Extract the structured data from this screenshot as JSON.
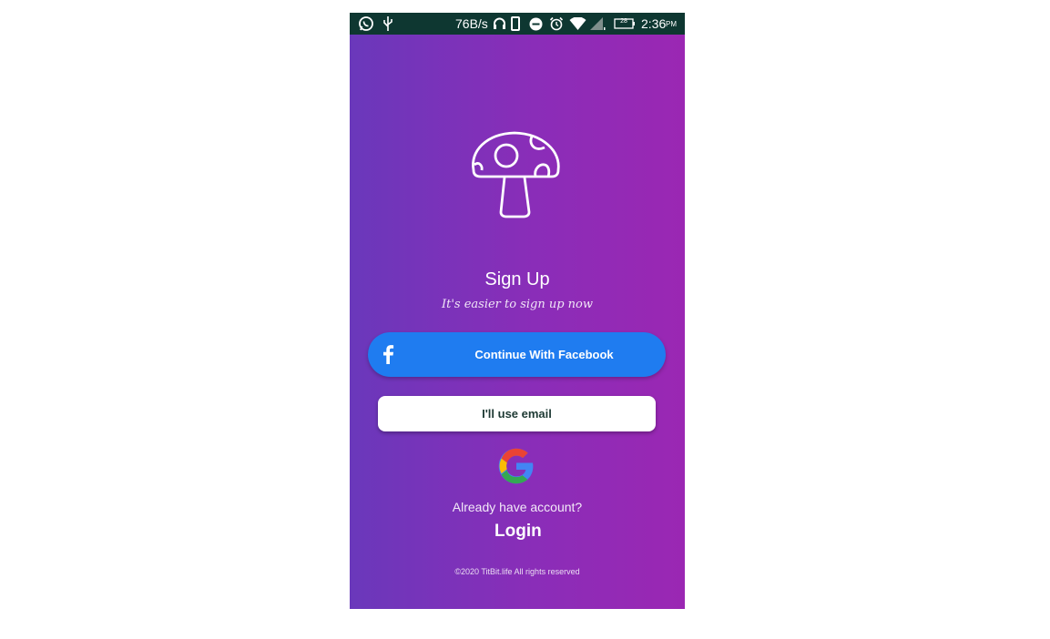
{
  "status_bar": {
    "net_speed": "76B/s",
    "battery_level": "28",
    "time": "2:36",
    "time_suffix": "PM",
    "icons": [
      "whatsapp-icon",
      "usb-icon",
      "headset-icon",
      "phone-icon",
      "do-not-disturb-icon",
      "alarm-icon",
      "wifi-icon",
      "cell-signal-icon",
      "battery-icon"
    ]
  },
  "signup": {
    "logo_icon": "mushroom-icon",
    "title": "Sign Up",
    "subtitle": "It's easier to sign up now"
  },
  "buttons": {
    "facebook_label": "Continue With Facebook",
    "facebook_icon": "facebook-icon",
    "facebook_color": "#1f7cf0",
    "email_label": "I'll use email",
    "google_icon": "google-icon"
  },
  "login_prompt": {
    "question": "Already have account?",
    "login_label": "Login"
  },
  "footer": {
    "copyright": "©2020 TitBit.life All rights reserved"
  },
  "colors": {
    "gradient_start": "#6a38bb",
    "gradient_end": "#9b27b3",
    "status_bar": "#0e3731"
  }
}
